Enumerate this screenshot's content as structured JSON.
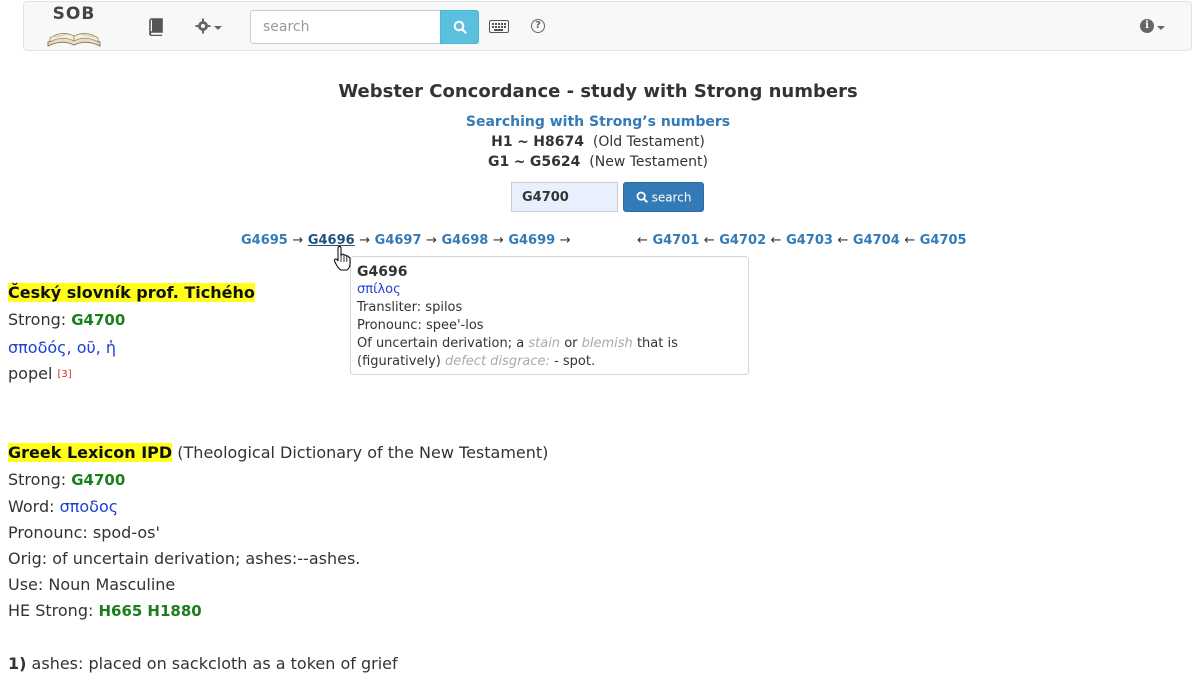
{
  "navbar": {
    "logo_text": "SOB",
    "search_placeholder": "search"
  },
  "page": {
    "title": "Webster Concordance - study with Strong numbers",
    "subtitle": "Searching with Strong’s numbers",
    "ot_range_start": "H1",
    "ot_range_sep": "~",
    "ot_range_end": "H8674",
    "ot_label": "(Old Testament)",
    "nt_range_start": "G1",
    "nt_range_sep": "~",
    "nt_range_end": "G5624",
    "nt_label": "(New Testament)",
    "strong_input_value": "G4700",
    "search_button_label": "search"
  },
  "strong_nav": {
    "prev": [
      "G4695",
      "G4696",
      "G4697",
      "G4698",
      "G4699"
    ],
    "next": [
      "G4701",
      "G4702",
      "G4703",
      "G4704",
      "G4705"
    ],
    "arrow_right": "→",
    "arrow_left": "←"
  },
  "tooltip": {
    "number": "G4696",
    "greek": "σπίλος",
    "translit": "Transliter: spilos",
    "pronounc": "Pronounc: spee'-los",
    "def_1": "Of uncertain derivation; a",
    "def_stain": "stain",
    "def_or": "or",
    "def_blemish": "blemish",
    "def_2": "that is",
    "def_3": "(figuratively)",
    "def_defect": "defect disgrace:",
    "def_4": "- spot."
  },
  "czech": {
    "heading": "Český slovník prof. Tichého",
    "strong_label": "Strong:",
    "strong_value": "G4700",
    "greek": "σποδός, οῦ, ἡ",
    "meaning": "popel",
    "ref": "[3]"
  },
  "greek_lexicon": {
    "heading": "Greek Lexicon IPD",
    "heading_note": "(Theological Dictionary of the New Testament)",
    "strong_label": "Strong:",
    "strong_value": "G4700",
    "word_label": "Word:",
    "word_value": "σποδος",
    "pronounc": "Pronounc: spod-os'",
    "orig": "Orig: of uncertain derivation; ashes:--ashes.",
    "use": "Use: Noun Masculine",
    "he_label": "HE Strong:",
    "he_value_1": "H665",
    "he_value_2": "H1880",
    "def_number": "1)",
    "def_text": "ashes: placed on sackcloth as a token of grief"
  }
}
